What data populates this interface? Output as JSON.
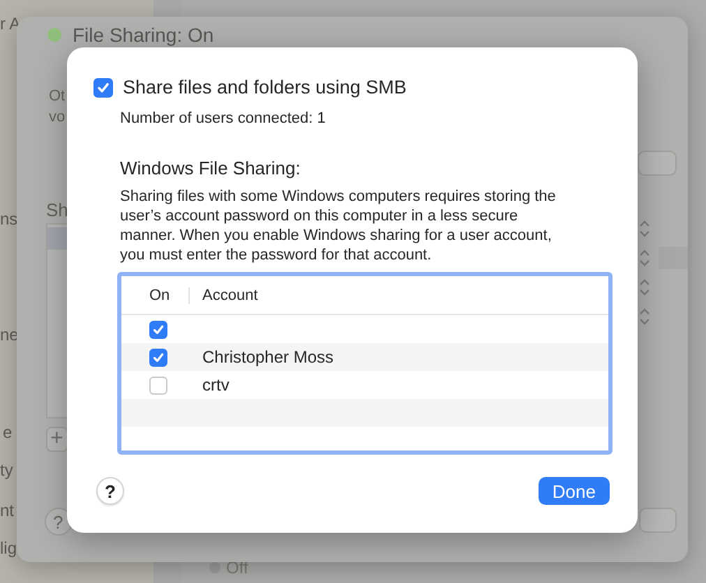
{
  "background": {
    "sidebar_items": [
      "r A",
      "ns",
      "ne",
      "e",
      "ty",
      "nt",
      "lig"
    ],
    "sheet": {
      "status": "File Sharing: On",
      "status_on": true,
      "description_lines": [
        "Ot",
        "vo"
      ],
      "list_label": "Sh",
      "add_button": "+",
      "help_button": "?"
    },
    "radio_option": {
      "label": "Off",
      "selected": false
    }
  },
  "dialog": {
    "smb": {
      "label": "Share files and folders using SMB",
      "checked": true
    },
    "users_connected": "Number of users connected: 1",
    "section_title": "Windows File Sharing:",
    "description": "Sharing files with some Windows computers requires storing the user’s account password on this computer in a less secure manner. When you enable Windows sharing for a user account, you must enter the password for that account.",
    "table": {
      "columns": [
        "On",
        "Account"
      ],
      "rows": [
        {
          "on": true
        },
        {
          "on": true,
          "account": "Christopher Moss"
        },
        {
          "on": false,
          "account": "crtv"
        }
      ]
    },
    "help_button": "?",
    "done_button": "Done"
  }
}
